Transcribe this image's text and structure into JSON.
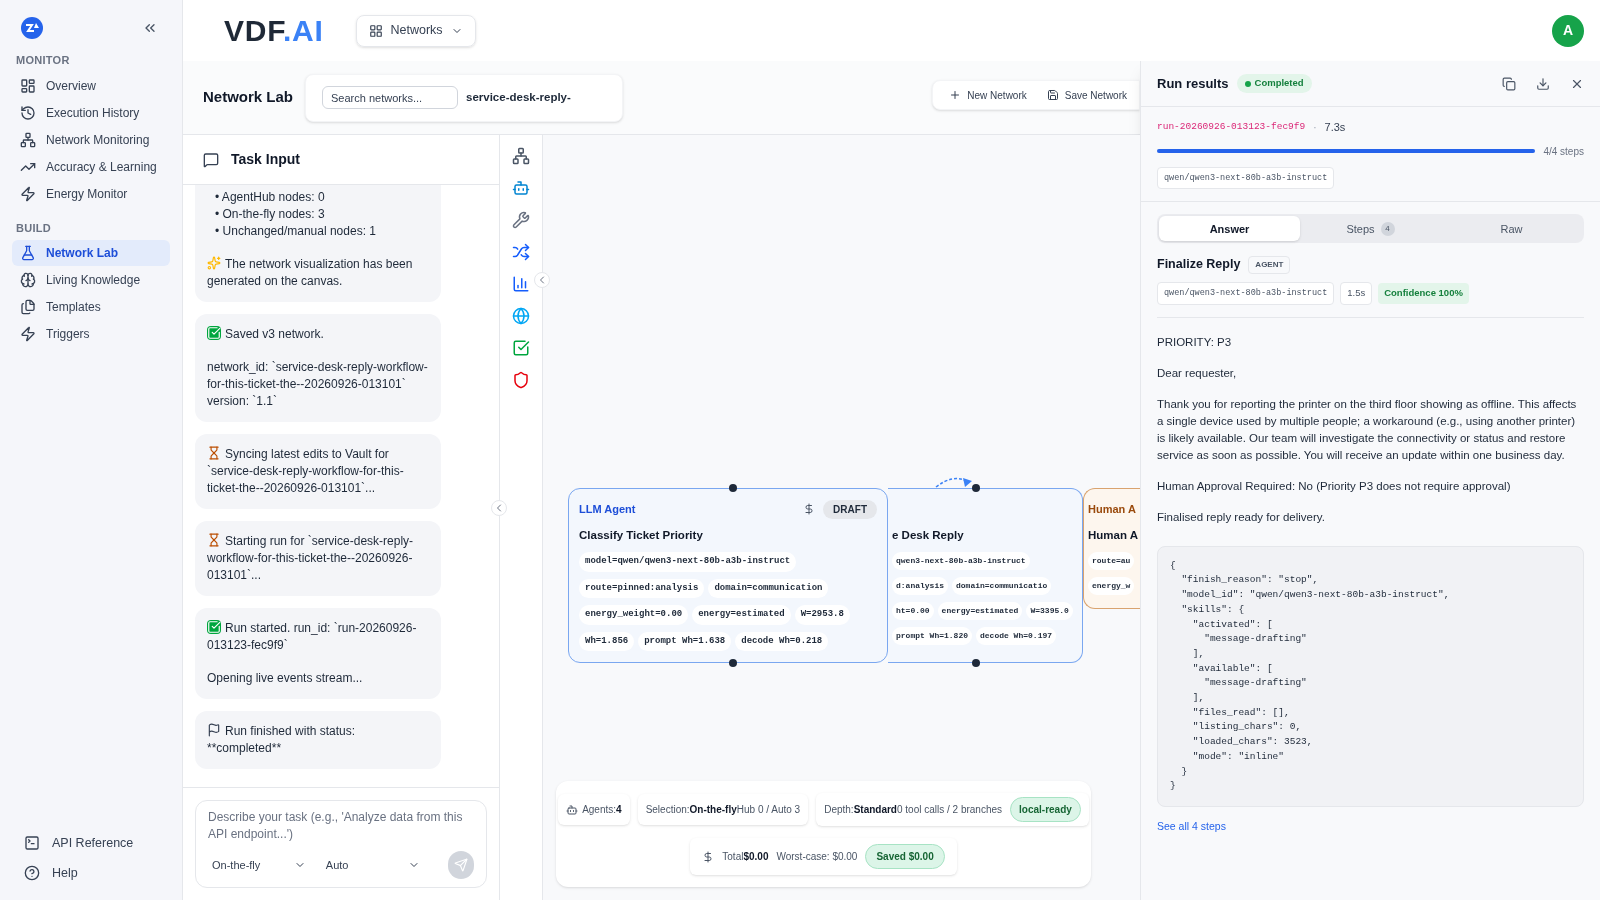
{
  "sidebar": {
    "sections": [
      {
        "heading": "MONITOR",
        "items": [
          {
            "label": "Overview",
            "selected": false
          },
          {
            "label": "Execution History",
            "selected": false
          },
          {
            "label": "Network Monitoring",
            "selected": false
          },
          {
            "label": "Accuracy & Learning",
            "selected": false
          },
          {
            "label": "Energy Monitor",
            "selected": false
          }
        ]
      },
      {
        "heading": "BUILD",
        "items": [
          {
            "label": "Network Lab",
            "selected": true
          },
          {
            "label": "Living Knowledge",
            "selected": false
          },
          {
            "label": "Templates",
            "selected": false
          },
          {
            "label": "Triggers",
            "selected": false
          }
        ]
      }
    ],
    "footer_items": [
      "API Reference",
      "Help"
    ]
  },
  "header": {
    "logo": {
      "text": "VDF",
      "accent": ".AI"
    },
    "networks_menu": "Networks",
    "avatar": "A"
  },
  "toolbar": {
    "title": "Network Lab",
    "search": {
      "placeholder": "Search networks..."
    },
    "network_name": "service-desk-reply-",
    "buttons": [
      "New Network",
      "Save Network"
    ]
  },
  "task_input": {
    "title": "Task Input",
    "messages": [
      {
        "kind": "info",
        "cut": true,
        "bullets": [
          "• AgentHub nodes: 0",
          "• On-the-fly nodes: 3",
          "• Unchanged/manual nodes: 1"
        ],
        "paragraphs": [
          "The network visualization has been generated on the canvas."
        ]
      },
      {
        "kind": "success",
        "paragraphs": [
          "Saved v3 network.",
          "network_id: `service-desk-reply-workflow-for-this-ticket-the--20260926-013101`\nversion: `1.1`"
        ]
      },
      {
        "kind": "pending",
        "paragraphs": [
          "Syncing latest edits to Vault for `service-desk-reply-workflow-for-this-ticket-the--20260926-013101`..."
        ]
      },
      {
        "kind": "pending",
        "paragraphs": [
          "Starting run for `service-desk-reply-workflow-for-this-ticket-the--20260926-013101`..."
        ]
      },
      {
        "kind": "success",
        "paragraphs": [
          "Run started. run_id: `run-20260926-013123-fec9f9`",
          "Opening live events stream..."
        ]
      },
      {
        "kind": "finished",
        "paragraphs": [
          "Run finished with status: **completed**"
        ]
      }
    ],
    "composer": {
      "placeholder": "Describe your task (e.g., 'Analyze data from this API endpoint...')",
      "mode": "On-the-fly",
      "depth": "Auto"
    }
  },
  "canvas": {
    "nodes": [
      {
        "kind": "agent",
        "kind_label": "LLM Agent",
        "title": "Classify Ticket Priority",
        "badge": "DRAFT",
        "selected": true,
        "chip_rows": [
          [
            "model=qwen/qwen3-next-80b-a3b-instruct"
          ],
          [
            "route=pinned:analysis",
            "domain=communication"
          ],
          [
            "energy_weight=0.00",
            "energy=estimated",
            "W=2953.8"
          ],
          [
            "Wh=1.856",
            "prompt Wh=1.638",
            "decode Wh=0.218"
          ]
        ]
      },
      {
        "kind": "agent",
        "title": "e Desk Reply",
        "selected": true,
        "chip_rows": [
          [
            "qwen3-next-80b-a3b-instruct"
          ],
          [
            "d:analysis",
            "domain=communicatio"
          ],
          [
            "ht=0.00",
            "energy=estimated",
            "W=3395.0"
          ],
          [
            "prompt Wh=1.820",
            "decode Wh=0.197"
          ]
        ]
      },
      {
        "kind": "human",
        "kind_label": "Human A",
        "title": "Human A",
        "selected": false,
        "chip_rows": [
          [
            "route=au"
          ],
          [
            "energy_w"
          ]
        ]
      }
    ],
    "summary": {
      "agents": {
        "label": "Agents:",
        "value": "4"
      },
      "selection": {
        "label": "Selection:",
        "value": "On-the-fly",
        "detail": "Hub 0 / Auto 3"
      },
      "depth": {
        "label": "Depth:",
        "value": "Standard",
        "detail": "0 tool calls / 2 branches",
        "badge": "local-ready"
      },
      "cost": {
        "label": "Total",
        "value": "$0.00",
        "worst_case": "Worst-case: $0.00",
        "saved": "Saved $0.00"
      }
    }
  },
  "run_results": {
    "title": "Run results",
    "status": "Completed",
    "run_id": "run-20260926-013123-fec9f9",
    "separator": "·",
    "duration": "7.3s",
    "progress": {
      "level": 1,
      "label": "4/4 steps"
    },
    "model": "qwen/qwen3-next-80b-a3b-instruct",
    "tabs": [
      {
        "label": "Answer",
        "selected": true
      },
      {
        "label": "Steps",
        "count": "4",
        "selected": false
      },
      {
        "label": "Raw",
        "selected": false
      }
    ],
    "step": {
      "title": "Finalize Reply",
      "type": "AGENT",
      "model": "qwen/qwen3-next-80b-a3b-instruct",
      "duration": "1.5s",
      "confidence": "Confidence 100%"
    },
    "answer": [
      "PRIORITY: P3",
      "Dear requester,",
      "Thank you for reporting the printer on the third floor showing as offline. This affects a single device used by multiple people; a workaround (e.g., using another printer) is likely available. Our team will investigate the connectivity or status and restore service as soon as possible. You will receive an update within one business day.",
      "Human Approval Required: No (Priority P3 does not require approval)",
      "Finalised reply ready for delivery."
    ],
    "raw_json": "{\n  \"finish_reason\": \"stop\",\n  \"model_id\": \"qwen/qwen3-next-80b-a3b-instruct\",\n  \"skills\": {\n    \"activated\": [\n      \"message-drafting\"\n    ],\n    \"available\": [\n      \"message-drafting\"\n    ],\n    \"files_read\": [],\n    \"listing_chars\": 0,\n    \"loaded_chars\": 3523,\n    \"mode\": \"inline\"\n  }\n}",
    "link": "See all 4 steps"
  }
}
